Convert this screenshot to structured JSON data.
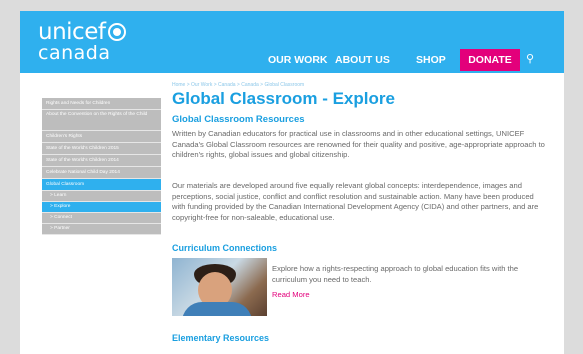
{
  "brand": {
    "name": "unicef",
    "sub": "canada",
    "logo_icon": "unicef-globe-icon"
  },
  "nav": {
    "our_work": "OUR WORK",
    "about_us": "ABOUT US",
    "shop": "SHOP",
    "donate": "DONATE",
    "search_icon": "search-icon"
  },
  "sidebar": {
    "items": [
      "Rights and Needs for Children",
      "About the Convention on the Rights of the Child",
      "Children's Rights",
      "State of the World's Children 2015",
      "State of the World's Children 2014",
      "Celebrate National Child Day 2014",
      "Global Classroom"
    ],
    "subitems": [
      "> Learn",
      "> Explore",
      "> Connect",
      "> Partner"
    ]
  },
  "breadcrumb": "Home > Our Work > Canada > Canada > Global Classroom",
  "page": {
    "title": "Global Classroom - Explore",
    "subtitle": "Global Classroom Resources",
    "para1": "Written by Canadian educators for practical use in classrooms and in other educational settings, UNICEF Canada's Global Classroom resources are renowned for their quality and positive, age-appropriate approach to children's rights, global issues and global citizenship.",
    "para2": "Our materials are developed around five equally relevant global concepts: interdependence, images and perceptions, social justice, conflict and conflict resolution and sustainable action. Many have been produced with funding provided by the Canadian International Development Agency (CIDA) and other partners, and are copyright-free for non-saleable, educational use.",
    "curriculum": {
      "heading": "Curriculum Connections",
      "text": "Explore how a rights-respecting approach to global education fits with the curriculum you need to teach.",
      "readmore": "Read More"
    },
    "elementary": {
      "heading": "Elementary Resources"
    }
  },
  "colors": {
    "primary": "#2fb0ee",
    "donate": "#e3007b",
    "title": "#1a9fe0",
    "sidebar_bg": "#bdbdbd"
  }
}
